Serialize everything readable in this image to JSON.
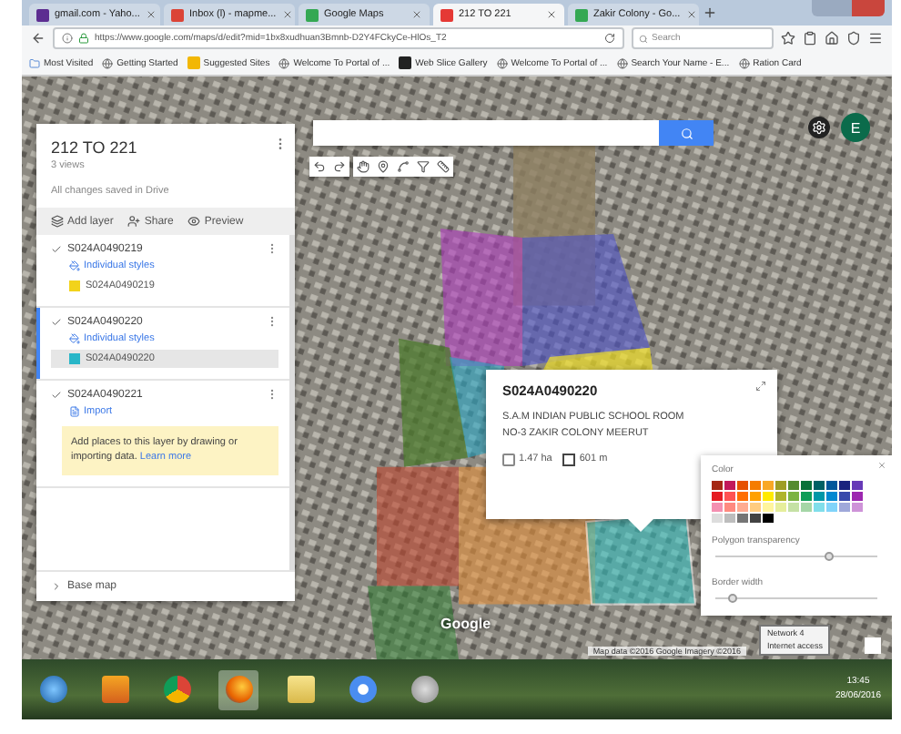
{
  "browser": {
    "tabs": [
      {
        "title": "gmail.com - Yaho...",
        "kind": "yahoo",
        "selected": false
      },
      {
        "title": "Inbox (l) - mapme...",
        "kind": "gmail",
        "selected": false
      },
      {
        "title": "Google Maps",
        "kind": "maps",
        "selected": false
      },
      {
        "title": "212 TO 221",
        "kind": "mymaps",
        "selected": true
      },
      {
        "title": "Zakir Colony - Go...",
        "kind": "maps",
        "selected": false
      }
    ],
    "url": "https://www.google.com/maps/d/edit?mid=1bx8xudhuan3Bmnb-D2Y4FCkyCe-HlOs_T2",
    "search": {
      "placeholder": "Search"
    },
    "bookmarks": [
      {
        "label": "Most Visited",
        "kind": "folder"
      },
      {
        "label": "Getting Started",
        "kind": "globe"
      },
      {
        "label": "Suggested Sites",
        "kind": "bing"
      },
      {
        "label": "Welcome To Portal of ...",
        "kind": "globe"
      },
      {
        "label": "Web Slice Gallery",
        "kind": "slice"
      },
      {
        "label": "Welcome To Portal of ...",
        "kind": "globe"
      },
      {
        "label": "Search Your Name - E...",
        "kind": "globe"
      },
      {
        "label": "Ration Card",
        "kind": "globe"
      }
    ]
  },
  "panel": {
    "title": "212 TO 221",
    "views": "3 views",
    "status": "All changes saved in Drive",
    "actions": [
      {
        "label": "Add layer",
        "kind": "add-layer"
      },
      {
        "label": "Share",
        "kind": "share"
      },
      {
        "label": "Preview",
        "kind": "preview"
      }
    ],
    "layers": [
      {
        "name": "S024A0490219",
        "checked": true,
        "selected": false,
        "style": "Individual styles",
        "items": [
          {
            "label": "S024A0490219",
            "color": "#f2d31b",
            "selected": false
          }
        ]
      },
      {
        "name": "S024A0490220",
        "checked": true,
        "selected": true,
        "style": "Individual styles",
        "items": [
          {
            "label": "S024A0490220",
            "color": "#29b6c8",
            "selected": true
          }
        ]
      },
      {
        "name": "S024A0490221",
        "checked": true,
        "selected": false,
        "import": "Import",
        "tip": "Add places to this layer by drawing or importing data.",
        "tip_link": "Learn more"
      }
    ],
    "base_map": "Base map"
  },
  "map": {
    "avatar": "E",
    "logo": "Google",
    "attribution": "Map data ©2016 Google Imagery ©2016",
    "popup": {
      "title": "S024A0490220",
      "description": "S.A.M INDIAN PUBLIC SCHOOL ROOM NO-3 ZAKIR COLONY MEERUT",
      "area": "1.47 ha",
      "perimeter": "601 m"
    },
    "style_picker": {
      "label": "Color",
      "palette": [
        {
          "color": "#a52714"
        },
        {
          "color": "#c2185b"
        },
        {
          "color": "#e65100"
        },
        {
          "color": "#f57c00"
        },
        {
          "color": "#f9a825"
        },
        {
          "color": "#9e9d24"
        },
        {
          "color": "#558b2f"
        },
        {
          "color": "#097138"
        },
        {
          "color": "#006064"
        },
        {
          "color": "#01579b"
        },
        {
          "color": "#1a237e"
        },
        {
          "color": "#673ab7"
        },
        {
          "color": "#e51c23"
        },
        {
          "color": "#ff5252"
        },
        {
          "color": "#ff6d00"
        },
        {
          "color": "#ffa000"
        },
        {
          "color": "#ffea00"
        },
        {
          "color": "#afb42b"
        },
        {
          "color": "#7cb342"
        },
        {
          "color": "#0f9d58"
        },
        {
          "color": "#0097a7"
        },
        {
          "color": "#0288d1"
        },
        {
          "color": "#3949ab"
        },
        {
          "color": "#9c27b0"
        },
        {
          "color": "#f48fb1"
        },
        {
          "color": "#ff8a80"
        },
        {
          "color": "#ffab91"
        },
        {
          "color": "#ffcc80"
        },
        {
          "color": "#fff59d"
        },
        {
          "color": "#e6ee9c"
        },
        {
          "color": "#c5e1a5"
        },
        {
          "color": "#a5d6a7"
        },
        {
          "color": "#80deea"
        },
        {
          "color": "#81d4fa"
        },
        {
          "color": "#9fa8da"
        },
        {
          "color": "#ce93d8"
        },
        {
          "color": "#dddddd"
        },
        {
          "color": "#bdbdbd"
        },
        {
          "color": "#757575"
        },
        {
          "color": "#424242"
        },
        {
          "color": "#000000"
        }
      ],
      "sliders": [
        {
          "label": "Polygon transparency",
          "level": 0.7
        },
        {
          "label": "Border width",
          "level": 0.1
        }
      ]
    }
  },
  "taskbar": {
    "apps": [
      {
        "kind": "start",
        "selected": false
      },
      {
        "kind": "media",
        "selected": false
      },
      {
        "kind": "chrome",
        "selected": false
      },
      {
        "kind": "firefox",
        "selected": true
      },
      {
        "kind": "explorer",
        "selected": false
      },
      {
        "kind": "chrome-blue",
        "selected": false
      },
      {
        "kind": "app",
        "selected": false
      }
    ],
    "tooltip": [
      "Network 4",
      "Internet access"
    ],
    "time": "13:45",
    "date": "28/06/2016"
  }
}
